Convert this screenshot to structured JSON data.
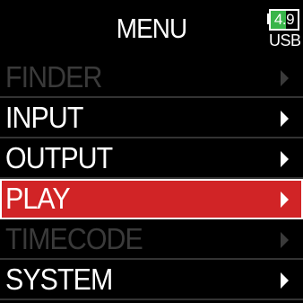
{
  "header": {
    "title": "MENU",
    "battery": {
      "value": "4.9",
      "level": 0.55,
      "fill_color": "#39b54a"
    },
    "power_source": "USB"
  },
  "menu": {
    "items": [
      {
        "label": "FINDER",
        "enabled": false,
        "selected": false,
        "icon": "chevron-right-icon"
      },
      {
        "label": "INPUT",
        "enabled": true,
        "selected": false,
        "icon": "chevron-right-icon"
      },
      {
        "label": "OUTPUT",
        "enabled": true,
        "selected": false,
        "icon": "chevron-right-icon"
      },
      {
        "label": "PLAY",
        "enabled": true,
        "selected": true,
        "icon": "chevron-right-icon"
      },
      {
        "label": "TIMECODE",
        "enabled": false,
        "selected": false,
        "icon": "chevron-right-icon"
      },
      {
        "label": "SYSTEM",
        "enabled": true,
        "selected": false,
        "icon": "chevron-right-icon"
      }
    ],
    "selected_color": "#d12426",
    "disabled_color": "#3a3a3a"
  }
}
